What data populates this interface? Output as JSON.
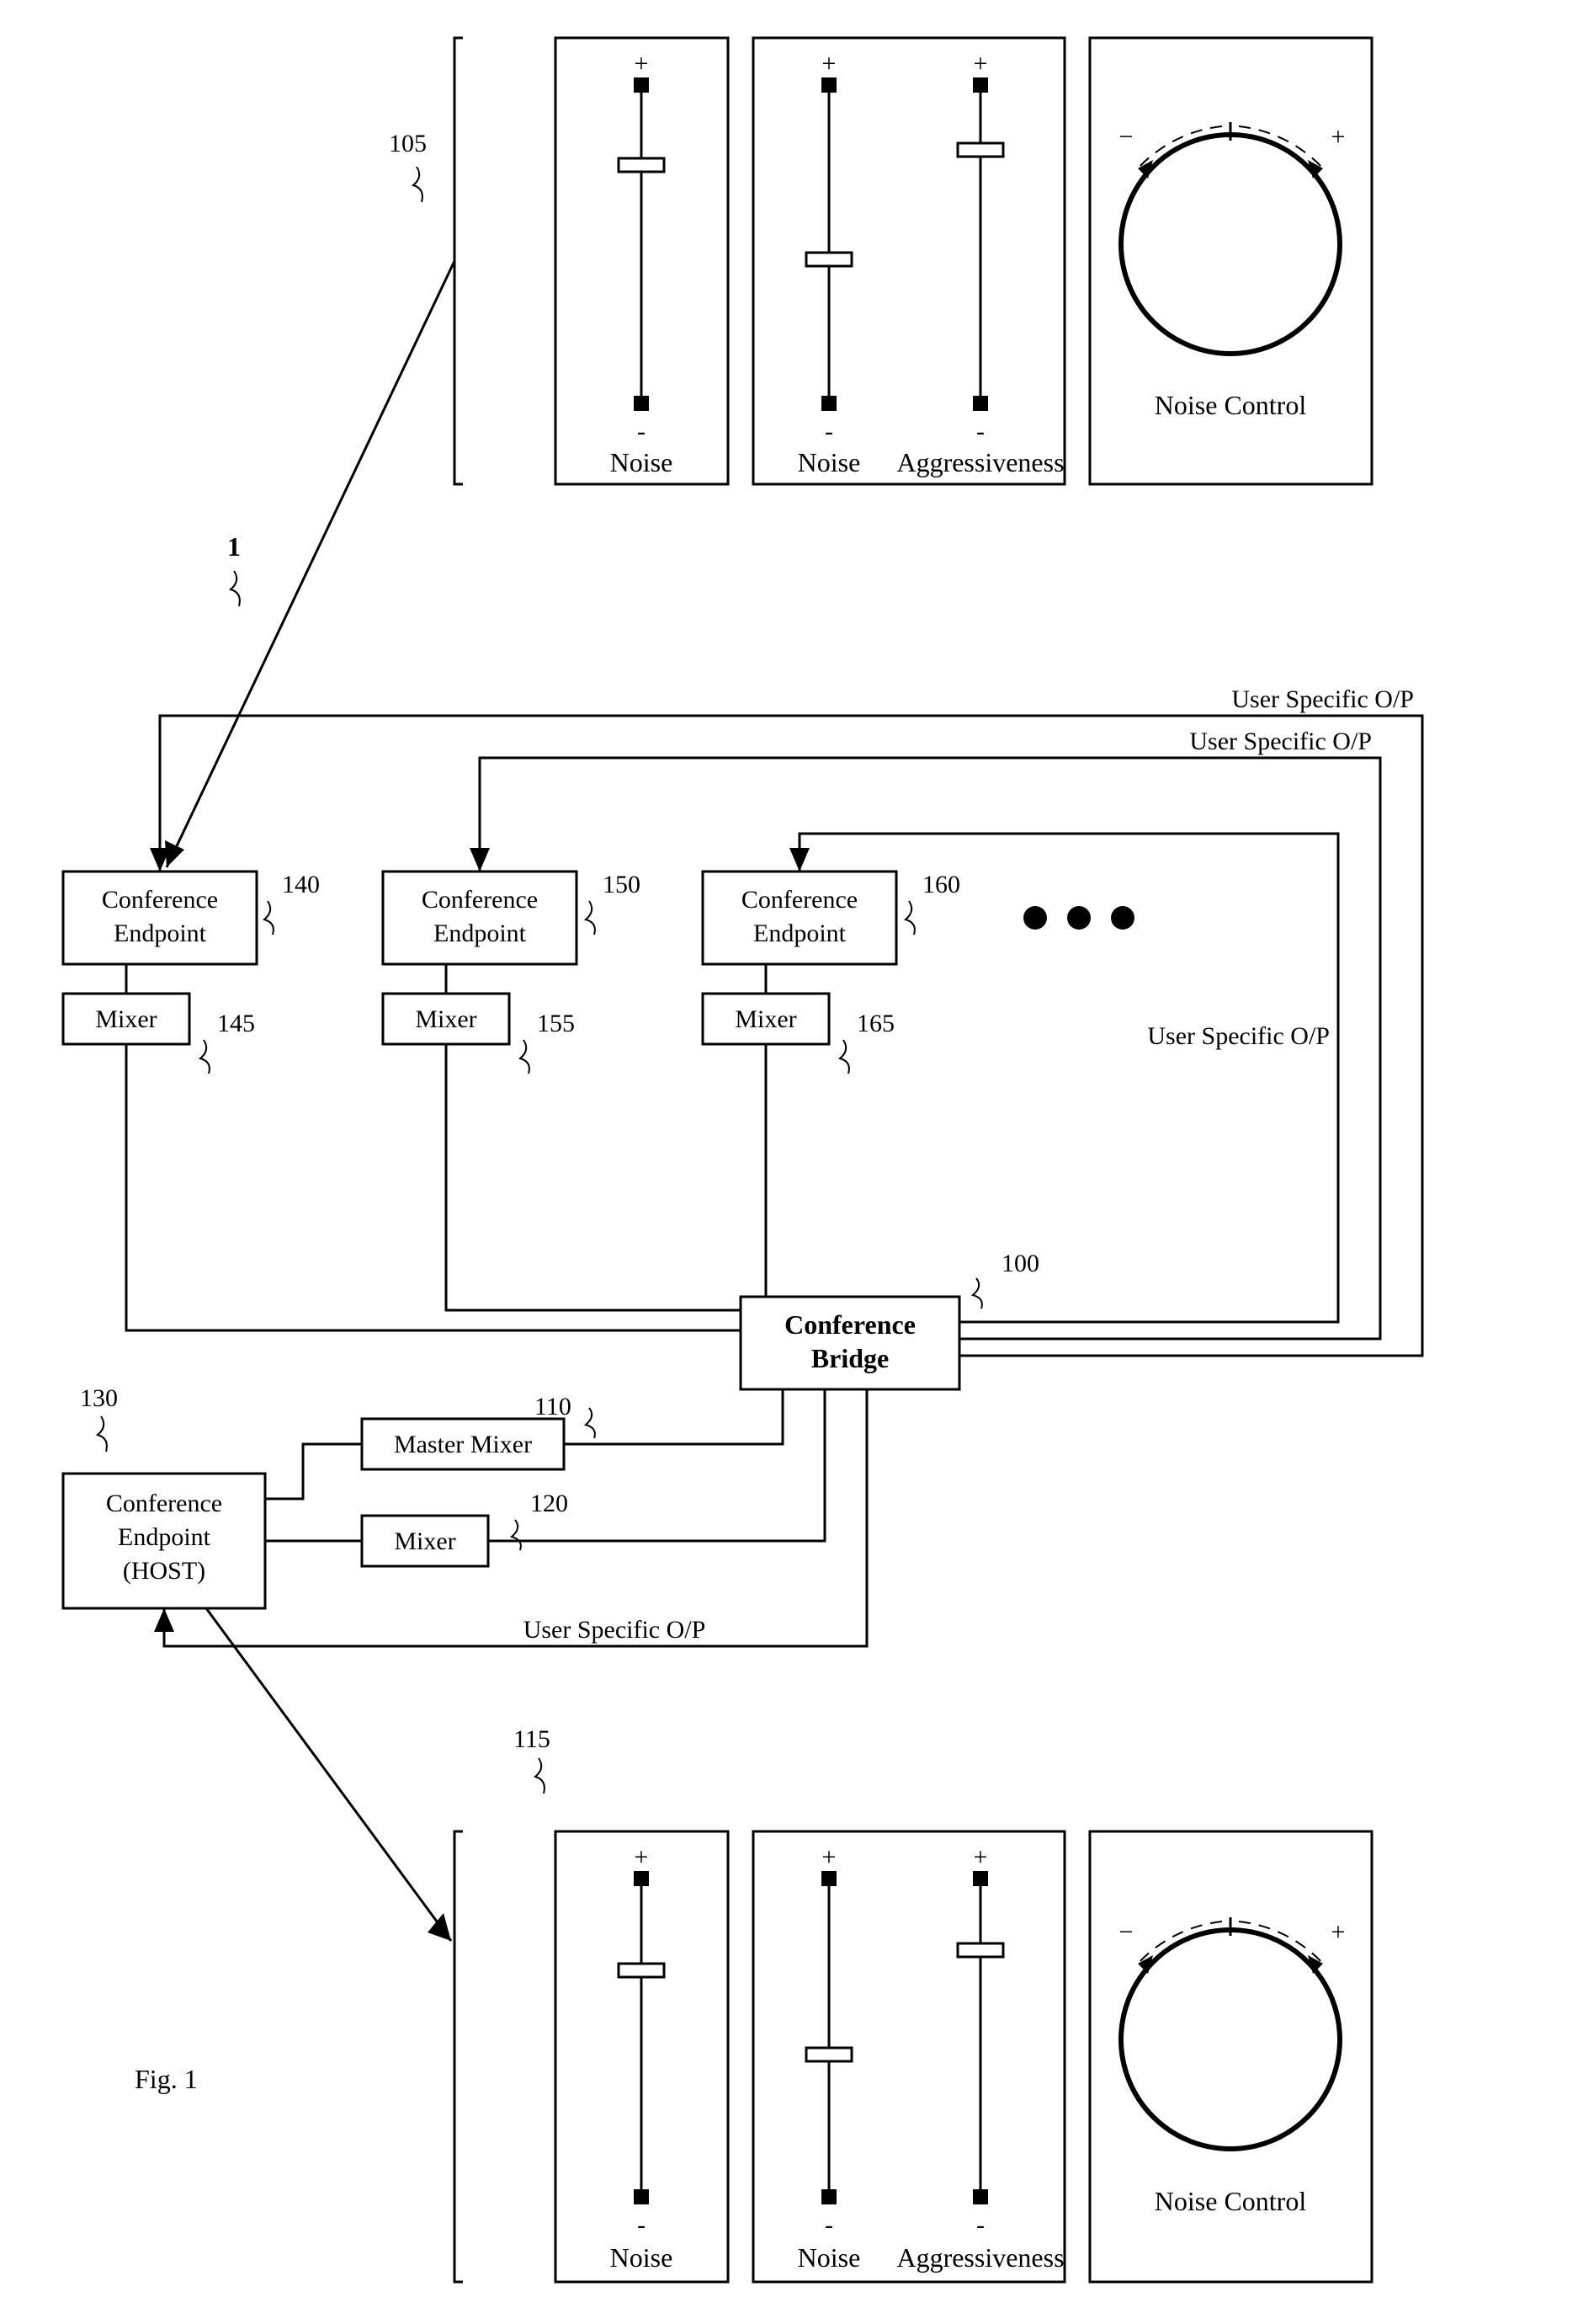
{
  "figureLabel": "Fig. 1",
  "systemRef": "1",
  "refs": {
    "topPanel": "105",
    "bridge": "100",
    "masterMixer": "110",
    "hostMixer": "120",
    "hostEndpoint": "130",
    "ep1": "140",
    "mx1": "145",
    "ep2": "150",
    "mx2": "155",
    "ep3": "160",
    "mx3": "165",
    "bottomPanel": "115"
  },
  "labels": {
    "confEndpoint1": "Conference",
    "confEndpoint2": "Endpoint",
    "mixer": "Mixer",
    "masterMixer": "Master Mixer",
    "bridge1": "Conference",
    "bridge2": "Bridge",
    "host1": "Conference",
    "host2": "Endpoint",
    "host3": "(HOST)",
    "userSpecOP": "User Specific O/P",
    "plus": "+",
    "minus": "-",
    "noise": "Noise",
    "aggressiveness": "Aggressiveness",
    "noiseControl": "Noise Control"
  },
  "sliders": {
    "top": {
      "panel1": {
        "noise": 0.75
      },
      "panel2": {
        "noise": 0.45,
        "aggressiveness": 0.8
      }
    },
    "bottom": {
      "panel1": {
        "noise": 0.7
      },
      "panel2": {
        "noise": 0.45,
        "aggressiveness": 0.78
      }
    }
  }
}
